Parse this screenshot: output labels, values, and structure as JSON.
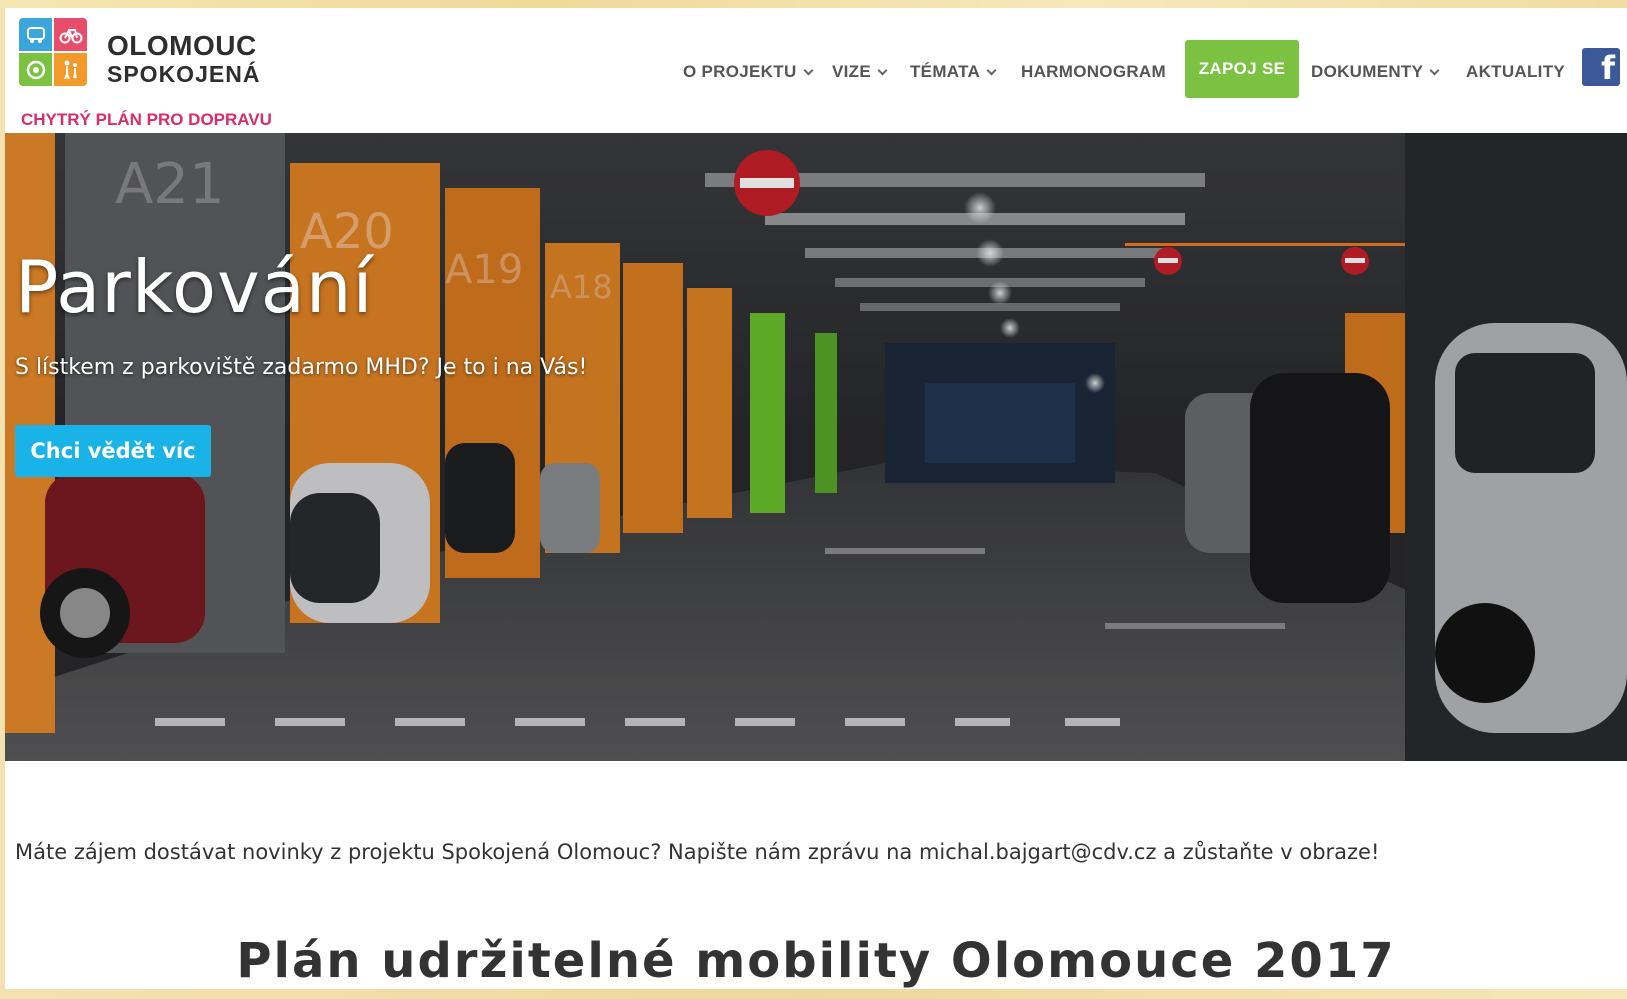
{
  "brand": {
    "title": "OLOMOUC",
    "subtitle": "SPOKOJENÁ",
    "tagline": "CHYTRÝ PLÁN PRO DOPRAVU",
    "colors": {
      "blue": "#3ba6dc",
      "pink": "#e84d6c",
      "green": "#7cc242",
      "orange": "#f39a2a",
      "tagline": "#d92c6b"
    }
  },
  "nav": {
    "items": [
      {
        "label": "O PROJEKTU",
        "dropdown": true
      },
      {
        "label": "VIZE",
        "dropdown": true
      },
      {
        "label": "TÉMATA",
        "dropdown": true
      },
      {
        "label": "HARMONOGRAM",
        "dropdown": false
      },
      {
        "label": "DOKUMENTY",
        "dropdown": true
      },
      {
        "label": "AKTUALITY",
        "dropdown": false
      }
    ],
    "cta_label": "ZAPOJ SE",
    "cta_color": "#7cc242",
    "social_icon": "facebook-icon",
    "social_glyph": "f"
  },
  "hero": {
    "title": "Parkování",
    "subtitle": "S lístkem z parkoviště zadarmo MHD? Je to i na Vás!",
    "button_label": "Chci vědět víc",
    "button_color": "#1ab3e8",
    "pillar_labels": [
      "A21",
      "A20",
      "A19",
      "A18"
    ]
  },
  "content": {
    "newsletter_text": "Máte zájem dostávat novinky z projektu Spokojená Olomouc? Napište nám zprávu na michal.bajgart@cdv.cz a zůstaňte v obraze!",
    "section_title": "Plán udržitelné mobility Olomouce 2017"
  }
}
